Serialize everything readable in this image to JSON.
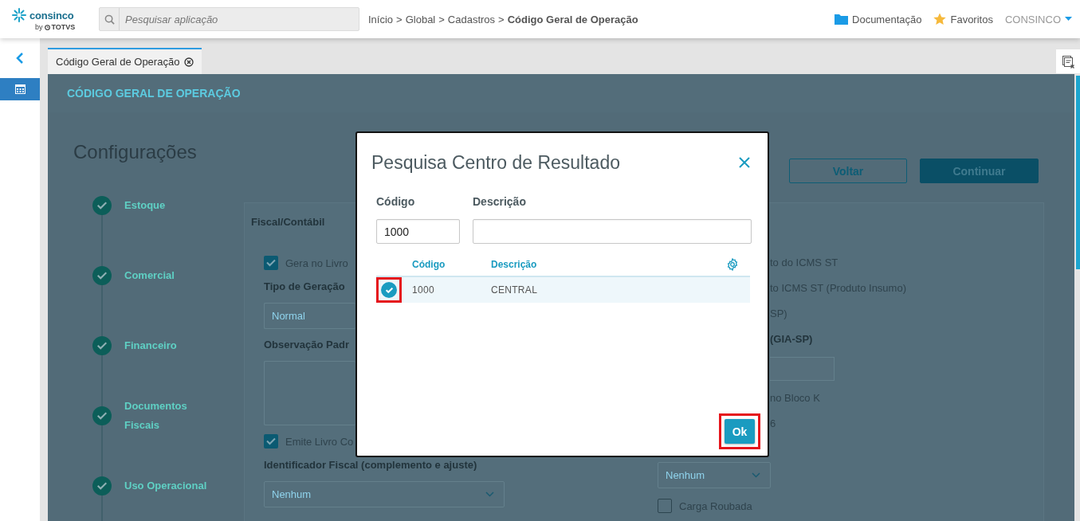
{
  "header": {
    "logo": {
      "name": "consinco",
      "by": "by",
      "brand": "TOTVS"
    },
    "search": {
      "placeholder": "Pesquisar aplicação"
    },
    "breadcrumb": [
      {
        "label": "Início",
        "current": false
      },
      {
        "label": "Global",
        "current": false
      },
      {
        "label": "Cadastros",
        "current": false
      },
      {
        "label": "Código Geral de Operação",
        "current": true
      }
    ],
    "breadcrumb_separator": ">",
    "links": [
      {
        "label": "Documentação",
        "kind": "docs"
      },
      {
        "label": "Favoritos",
        "kind": "favorites"
      }
    ],
    "user": "CONSINCO"
  },
  "sidebar": {
    "items": [
      {
        "selected": true
      }
    ]
  },
  "tabs": [
    {
      "label": "Código Geral de Operação",
      "selected": true
    }
  ],
  "page": {
    "title": "CÓDIGO GERAL DE OPERAÇÃO",
    "heading": "Configurações",
    "buttons": [
      {
        "label": "Voltar",
        "kind": "outline"
      },
      {
        "label": "Continuar",
        "kind": "primary"
      }
    ],
    "steps": [
      {
        "label": "Estoque",
        "done": true
      },
      {
        "label": "Comercial",
        "done": true
      },
      {
        "label": "Financeiro",
        "done": true
      },
      {
        "label": "Documentos Fiscais",
        "done": true
      },
      {
        "label": "Uso Operacional",
        "done": true
      }
    ],
    "card": {
      "title": "Fiscal/Contábil",
      "left": [
        {
          "kind": "checkbox",
          "label": "Gera no Livro",
          "checked": true
        },
        {
          "kind": "label",
          "text": "Tipo de Geração"
        },
        {
          "kind": "select",
          "value": "Normal"
        },
        {
          "kind": "label",
          "text": "Observação Padr"
        },
        {
          "kind": "textarea"
        },
        {
          "kind": "checkbox",
          "label": "Emite Livro Co",
          "checked": true
        },
        {
          "kind": "label",
          "text": "Identificador Fiscal (complemento e ajuste)"
        },
        {
          "kind": "select",
          "value": "Nenhum"
        }
      ],
      "right": [
        {
          "kind": "text",
          "text": "to do ICMS ST"
        },
        {
          "kind": "text",
          "text": "to ICMS ST (Produto Insumo)"
        },
        {
          "kind": "text",
          "text": "SP)"
        },
        {
          "kind": "label",
          "text": "(GIA-SP)"
        },
        {
          "kind": "input"
        },
        {
          "kind": "text",
          "text": "no Bloco K"
        },
        {
          "kind": "text",
          "text": "6"
        },
        {
          "kind": "select",
          "value": "Nenhum"
        },
        {
          "kind": "checkbox",
          "label": "Carga Roubada",
          "checked": false
        }
      ]
    }
  },
  "modal": {
    "title": "Pesquisa Centro de Resultado",
    "fields": [
      {
        "label": "Código",
        "value": "1000"
      },
      {
        "label": "Descrição"
      }
    ],
    "table": {
      "columns": [
        "Código",
        "Descrição"
      ],
      "rows": [
        {
          "cells": [
            "1000",
            "CENTRAL"
          ],
          "selected": true,
          "highlighted": true
        }
      ]
    },
    "buttons": [
      {
        "label": "Ok",
        "highlighted": true
      }
    ]
  }
}
